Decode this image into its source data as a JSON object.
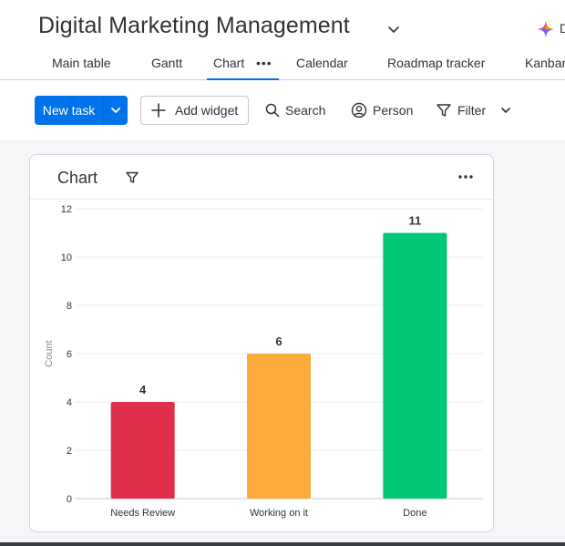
{
  "board": {
    "title": "Digital Marketing Management",
    "ai_text": "D"
  },
  "tabs": [
    {
      "label": "Main table",
      "active": false
    },
    {
      "label": "Gantt",
      "active": false
    },
    {
      "label": "Chart",
      "active": true
    },
    {
      "label": "Calendar",
      "active": false
    },
    {
      "label": "Roadmap tracker",
      "active": false
    },
    {
      "label": "Kanban",
      "active": false
    }
  ],
  "toolbar": {
    "new_task_label": "New task",
    "add_widget_label": "Add widget",
    "search_label": "Search",
    "person_label": "Person",
    "filter_label": "Filter"
  },
  "widget": {
    "title": "Chart"
  },
  "colors": {
    "accent": "#0073ea",
    "needs_review": "#df2f4a",
    "working_on_it": "#fdab3d",
    "done": "#00c875"
  },
  "chart_data": {
    "type": "bar",
    "categories": [
      "Needs Review",
      "Working on it",
      "Done"
    ],
    "values": [
      4,
      6,
      11
    ],
    "colors": [
      "#df2f4a",
      "#fdab3d",
      "#00c875"
    ],
    "ylabel": "Count",
    "xlabel": "",
    "ylim": [
      0,
      12
    ],
    "yticks": [
      0,
      2,
      4,
      6,
      8,
      10,
      12
    ],
    "grid": true,
    "data_labels": true
  }
}
